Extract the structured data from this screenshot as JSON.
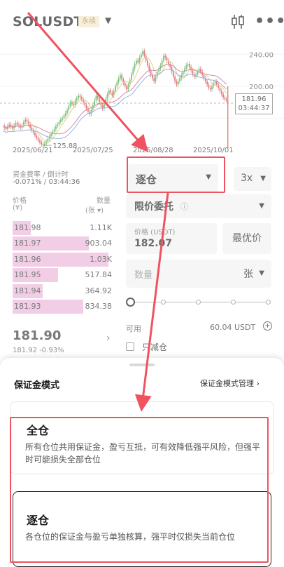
{
  "header": {
    "pair": "SOLUSDT",
    "badge": "永续",
    "more": "•••"
  },
  "chart": {
    "price_axis": [
      "240.00",
      "200.00"
    ],
    "low_label": "125.88",
    "current_price": "181.96",
    "countdown": "03:44:37",
    "dates": [
      "2025/06/21",
      "2025/07/25",
      "2025/08/28",
      "2025/10/01"
    ]
  },
  "funding": {
    "label": "资金费率 / 倒计时",
    "value": "-0.071% / 03:44:36"
  },
  "orderbook": {
    "price_header": "价格",
    "price_unit": "(¥)",
    "qty_header": "数量",
    "qty_unit": "(张 ▾)",
    "asks": [
      {
        "price": "181.98",
        "qty": "1.11K",
        "depth": 0.18
      },
      {
        "price": "181.97",
        "qty": "903.04",
        "depth": 0.76
      },
      {
        "price": "181.96",
        "qty": "1.03K",
        "depth": 0.95
      },
      {
        "price": "181.95",
        "qty": "517.84",
        "depth": 0.45
      },
      {
        "price": "181.94",
        "qty": "364.92",
        "depth": 0.3
      },
      {
        "price": "181.93",
        "qty": "834.38",
        "depth": 0.7
      }
    ],
    "last_price": "181.90",
    "last_sub": "181.92 -0.93%"
  },
  "form": {
    "margin_mode": "逐仓",
    "leverage": "3x",
    "order_type": "限价委托",
    "price_label": "价格 (USDT)",
    "price_value": "182.07",
    "best_price": "最优价",
    "qty_placeholder": "数量",
    "qty_unit": "张",
    "available_label": "可用",
    "available_value": "60.04 USDT",
    "reduce_only": "只减仓"
  },
  "sheet": {
    "title": "保证金模式",
    "manage": "保证金模式管理 ›",
    "options": [
      {
        "title": "全仓",
        "desc": "所有仓位共用保证金，盈亏互抵，可有效降低强平风险，但强平时可能损失全部仓位"
      },
      {
        "title": "逐仓",
        "desc": "各仓位的保证金与盈亏单独核算，强平时仅损失当前仓位"
      }
    ]
  },
  "colors": {
    "annotation": "#f0535f",
    "ask_depth": "#ecb3d9",
    "candle_up": "#3aa33a",
    "candle_down": "#d23b3b"
  }
}
